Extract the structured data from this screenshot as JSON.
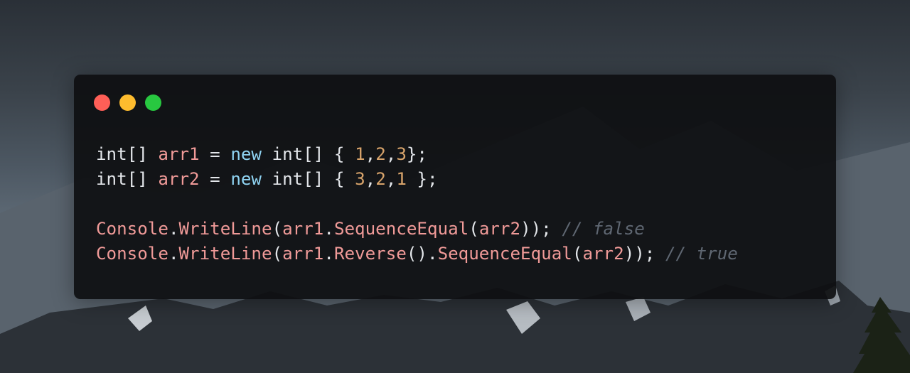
{
  "colors": {
    "close": "#ff5f57",
    "minimize": "#febc2e",
    "maximize": "#28c840",
    "window_bg": "#0e0f11",
    "text": "#e3e6ea",
    "identifier": "#f09a98",
    "keyword": "#8fd3f2",
    "number": "#d8a46b",
    "comment": "#5f6772"
  },
  "window_controls": [
    {
      "name": "close-button",
      "color": "#ff5f57"
    },
    {
      "name": "minimize-button",
      "color": "#febc2e"
    },
    {
      "name": "maximize-button",
      "color": "#28c840"
    }
  ],
  "code_lines": [
    [
      {
        "t": "int[] ",
        "k": "text"
      },
      {
        "t": "arr1",
        "k": "identifier"
      },
      {
        "t": " = ",
        "k": "text"
      },
      {
        "t": "new",
        "k": "keyword"
      },
      {
        "t": " int[] { ",
        "k": "text"
      },
      {
        "t": "1",
        "k": "number"
      },
      {
        "t": ",",
        "k": "text"
      },
      {
        "t": "2",
        "k": "number"
      },
      {
        "t": ",",
        "k": "text"
      },
      {
        "t": "3",
        "k": "number"
      },
      {
        "t": "};",
        "k": "text"
      }
    ],
    [
      {
        "t": "int[] ",
        "k": "text"
      },
      {
        "t": "arr2",
        "k": "identifier"
      },
      {
        "t": " = ",
        "k": "text"
      },
      {
        "t": "new",
        "k": "keyword"
      },
      {
        "t": " int[] { ",
        "k": "text"
      },
      {
        "t": "3",
        "k": "number"
      },
      {
        "t": ",",
        "k": "text"
      },
      {
        "t": "2",
        "k": "number"
      },
      {
        "t": ",",
        "k": "text"
      },
      {
        "t": "1",
        "k": "number"
      },
      {
        "t": " };",
        "k": "text"
      }
    ],
    [],
    [
      {
        "t": "Console",
        "k": "identifier"
      },
      {
        "t": ".",
        "k": "text"
      },
      {
        "t": "WriteLine",
        "k": "identifier"
      },
      {
        "t": "(",
        "k": "text"
      },
      {
        "t": "arr1",
        "k": "identifier"
      },
      {
        "t": ".",
        "k": "text"
      },
      {
        "t": "SequenceEqual",
        "k": "identifier"
      },
      {
        "t": "(",
        "k": "text"
      },
      {
        "t": "arr2",
        "k": "identifier"
      },
      {
        "t": ")); ",
        "k": "text"
      },
      {
        "t": "// false",
        "k": "comment"
      }
    ],
    [
      {
        "t": "Console",
        "k": "identifier"
      },
      {
        "t": ".",
        "k": "text"
      },
      {
        "t": "WriteLine",
        "k": "identifier"
      },
      {
        "t": "(",
        "k": "text"
      },
      {
        "t": "arr1",
        "k": "identifier"
      },
      {
        "t": ".",
        "k": "text"
      },
      {
        "t": "Reverse",
        "k": "identifier"
      },
      {
        "t": "().",
        "k": "text"
      },
      {
        "t": "SequenceEqual",
        "k": "identifier"
      },
      {
        "t": "(",
        "k": "text"
      },
      {
        "t": "arr2",
        "k": "identifier"
      },
      {
        "t": ")); ",
        "k": "text"
      },
      {
        "t": "// true",
        "k": "comment"
      }
    ]
  ]
}
